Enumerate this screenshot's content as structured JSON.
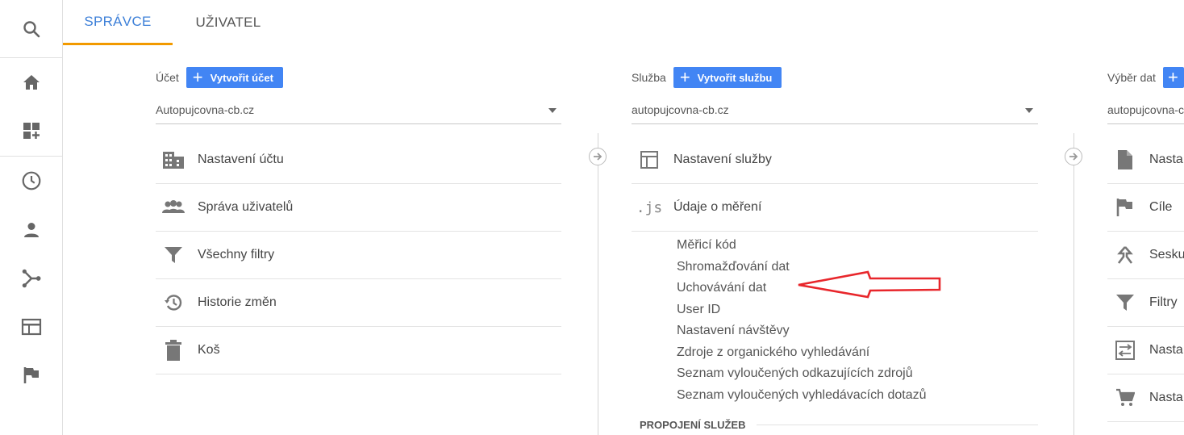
{
  "tabs": {
    "admin": "SPRÁVCE",
    "user": "UŽIVATEL"
  },
  "rail": {
    "items": [
      "search-icon",
      "home-icon",
      "customization-icon",
      "realtime-icon",
      "audience-icon",
      "acquisition-icon",
      "behavior-icon",
      "conversions-icon"
    ]
  },
  "account": {
    "label": "Účet",
    "create_label": "Vytvořit účet",
    "selected": "Autopujcovna-cb.cz",
    "items": [
      "Nastavení účtu",
      "Správa uživatelů",
      "Všechny filtry",
      "Historie změn",
      "Koš"
    ]
  },
  "property": {
    "label": "Služba",
    "create_label": "Vytvořit službu",
    "selected": "autopujcovna-cb.cz",
    "items": [
      "Nastavení služby",
      "Údaje o měření"
    ],
    "js_icon_text": ".js",
    "tracking_subitems": [
      "Měřicí kód",
      "Shromažďování dat",
      "Uchovávání dat",
      "User ID",
      "Nastavení návštěvy",
      "Zdroje z organického vyhledávání",
      "Seznam vyloučených odkazujících zdrojů",
      "Seznam vyloučených vyhledávacích dotazů"
    ],
    "section_heading": "PROPOJENÍ SLUŽEB"
  },
  "view": {
    "label": "Výběr dat",
    "selected": "autopujcovna-cl",
    "items": [
      "Nasta",
      "Cíle",
      "Sesku",
      "Filtry",
      "Nasta",
      "Nasta"
    ]
  },
  "colors": {
    "accent": "#4285f4",
    "tab_active": "#3c7fd8",
    "tab_underline": "#f29a00",
    "annotation_arrow": "#e8262b"
  }
}
